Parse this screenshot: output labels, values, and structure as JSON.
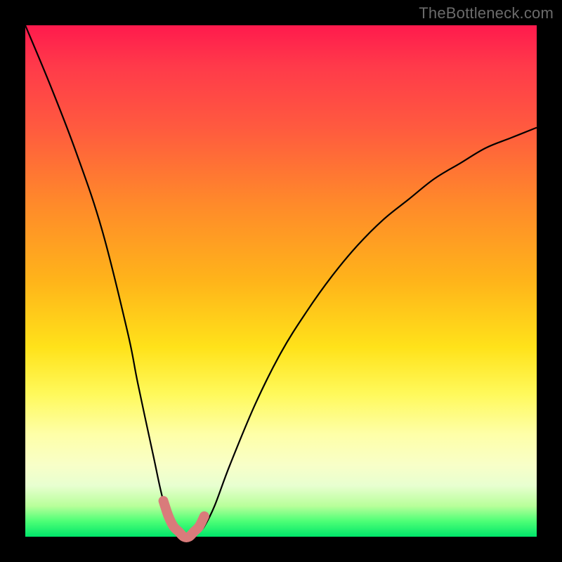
{
  "watermark": "TheBottleneck.com",
  "colors": {
    "background": "#000000",
    "curve": "#000000",
    "minimum_highlight": "#d97b7b",
    "gradient_top": "#ff1a4d",
    "gradient_bottom": "#00e56a"
  },
  "chart_data": {
    "type": "line",
    "title": "",
    "xlabel": "",
    "ylabel": "",
    "xlim": [
      0,
      100
    ],
    "ylim": [
      0,
      100
    ],
    "note": "Bottleneck-style curve plot. Y is bottleneck percentage (0 at bottom = no bottleneck, 100 at top = full bottleneck). X is a hardware-scaling axis. Values estimated from pixels; no axis ticks or labels are shown in the source image.",
    "series": [
      {
        "name": "bottleneck-curve",
        "x": [
          0,
          5,
          10,
          15,
          20,
          22,
          25,
          27,
          29,
          30,
          31,
          32,
          33,
          34,
          35,
          37,
          40,
          45,
          50,
          55,
          60,
          65,
          70,
          75,
          80,
          85,
          90,
          95,
          100
        ],
        "y": [
          100,
          88,
          75,
          60,
          40,
          30,
          16,
          7,
          2,
          1,
          0,
          0,
          0,
          1,
          2,
          6,
          14,
          26,
          36,
          44,
          51,
          57,
          62,
          66,
          70,
          73,
          76,
          78,
          80
        ]
      },
      {
        "name": "minimum-highlight",
        "x": [
          27,
          28,
          29,
          30,
          31,
          32,
          33,
          34,
          35
        ],
        "y": [
          7,
          4,
          2,
          1,
          0,
          0,
          1,
          2,
          4
        ]
      }
    ],
    "minimum_at_x": 31
  }
}
